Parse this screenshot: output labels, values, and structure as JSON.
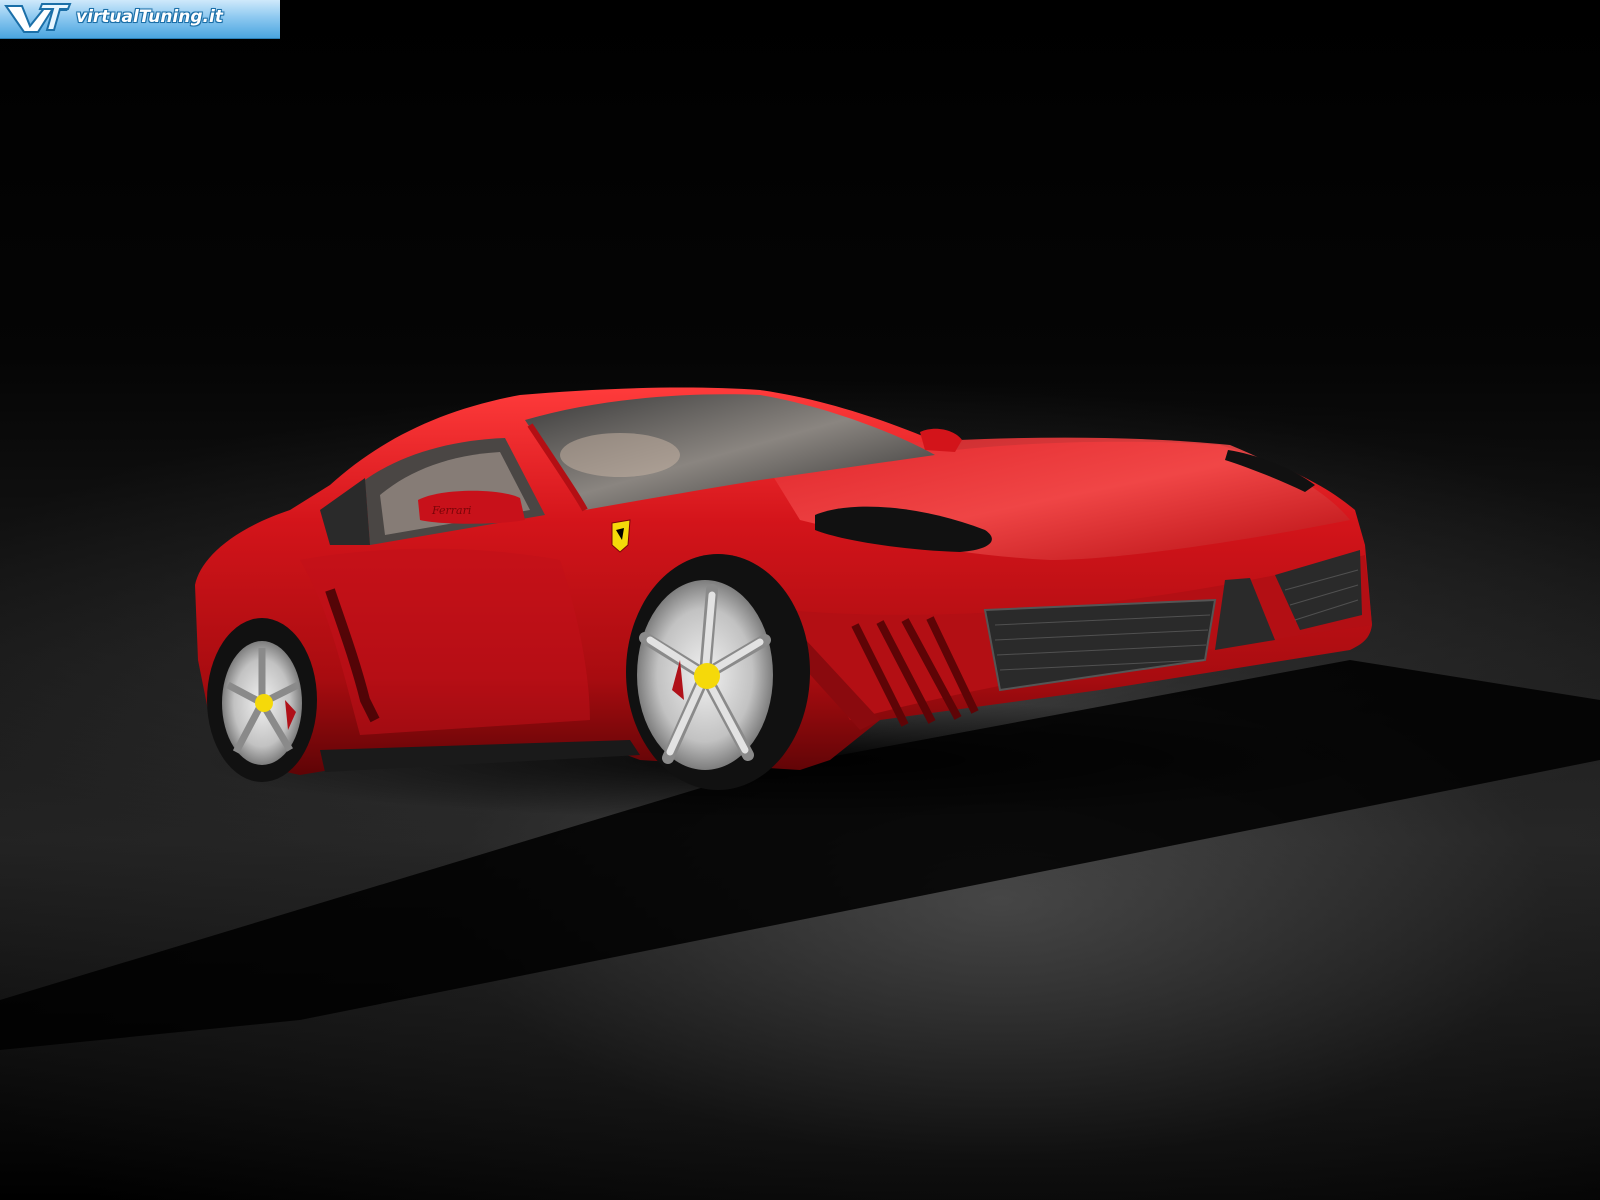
{
  "watermark": {
    "text": "virtualTuning.it",
    "logo_letters": "VT",
    "colors": {
      "band_top": "#cfe9fb",
      "band_bottom": "#4aa5e0",
      "text_outline": "#1b6fa8"
    }
  },
  "scene": {
    "subject": "red-sports-car",
    "mirror_script": "Ferrari",
    "colors": {
      "body": "#d3141a",
      "body_dark": "#7a0508",
      "background": "#000000",
      "floor_light": "#5a5a5a",
      "wheel": "#c9c9c9"
    }
  }
}
